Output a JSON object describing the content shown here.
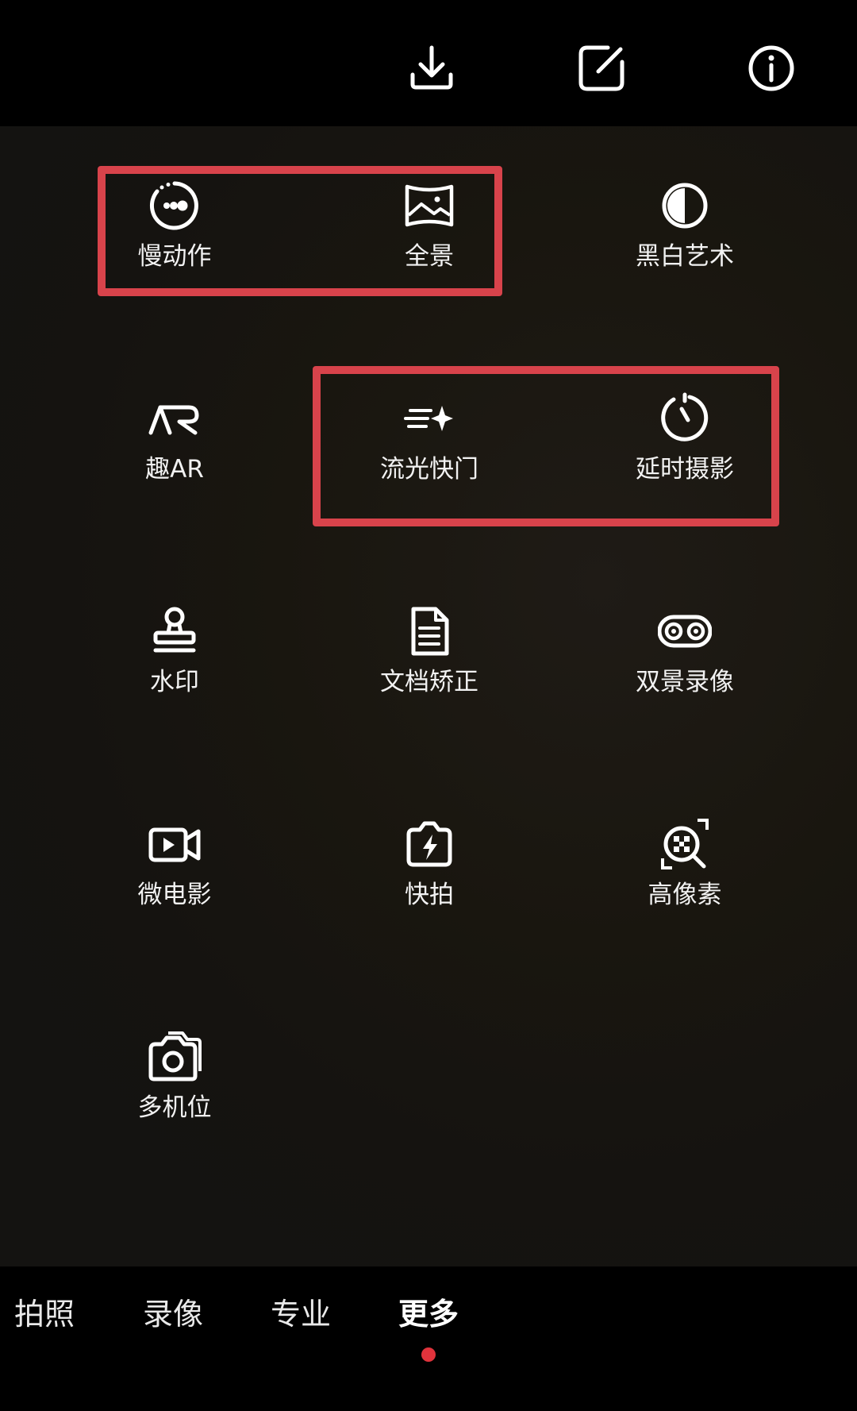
{
  "top_bar": {
    "icons": [
      "download-icon",
      "edit-icon",
      "info-icon"
    ]
  },
  "modes": [
    {
      "label": "慢动作",
      "icon": "slow-motion-icon"
    },
    {
      "label": "全景",
      "icon": "panorama-icon"
    },
    {
      "label": "黑白艺术",
      "icon": "monochrome-icon"
    },
    {
      "label": "趣AR",
      "icon": "ar-icon"
    },
    {
      "label": "流光快门",
      "icon": "light-trail-icon"
    },
    {
      "label": "延时摄影",
      "icon": "timelapse-icon"
    },
    {
      "label": "水印",
      "icon": "watermark-stamp-icon"
    },
    {
      "label": "文档矫正",
      "icon": "document-icon"
    },
    {
      "label": "双景录像",
      "icon": "dual-view-icon"
    },
    {
      "label": "微电影",
      "icon": "micro-movie-icon"
    },
    {
      "label": "快拍",
      "icon": "quick-snap-icon"
    },
    {
      "label": "高像素",
      "icon": "high-resolution-icon"
    },
    {
      "label": "多机位",
      "icon": "multi-camera-icon"
    }
  ],
  "bottom_tabs": [
    {
      "label": "拍照",
      "active": false
    },
    {
      "label": "录像",
      "active": false
    },
    {
      "label": "专业",
      "active": false
    },
    {
      "label": "更多",
      "active": true
    }
  ],
  "colors": {
    "highlight_border": "#d8434b",
    "active_dot": "#e1333c",
    "panel_background": "#19160f"
  }
}
